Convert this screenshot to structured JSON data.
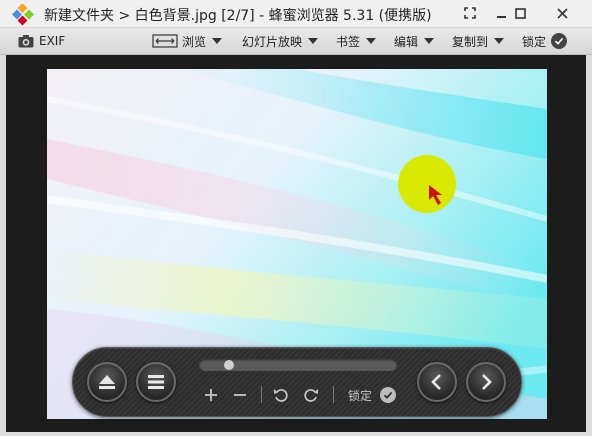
{
  "window": {
    "title": "新建文件夹 > 白色背景.jpg [2/7] - 蜂蜜浏览器 5.31 (便携版)",
    "controls": {
      "fullscreen": "⛶",
      "minimize": "—",
      "maximize": "☐",
      "close": "✕"
    }
  },
  "toolbar": {
    "exif_label": "EXIF",
    "browse_label": "浏览",
    "slideshow_label": "幻灯片放映",
    "bookmarks_label": "书签",
    "edit_label": "编辑",
    "copy_to_label": "复制到",
    "lock_label": "锁定"
  },
  "controlbar": {
    "lock_label": "锁定",
    "slider_position": 0.13
  },
  "colors": {
    "accent_yellow": "#d8e800",
    "cursor_red": "#cc1111",
    "toolbar_bg": "#dfdfdf",
    "viewer_bg": "#1c1c1c"
  }
}
